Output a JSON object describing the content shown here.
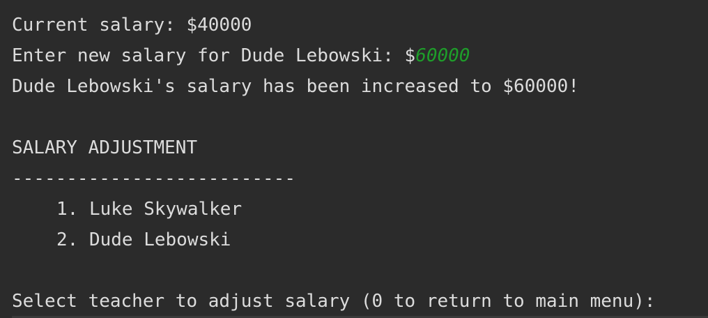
{
  "terminal": {
    "colors": {
      "background": "#2b2b2b",
      "text": "#dcdcdc",
      "input": "#1e9e2a"
    },
    "line1": "Current salary: $40000",
    "line2": {
      "prompt": "Enter new salary for Dude Lebowski: $",
      "input": "60000"
    },
    "line3": "Dude Lebowski's salary has been increased to $60000!",
    "menu": {
      "title": "SALARY ADJUSTMENT",
      "divider": "--------------------------",
      "items": [
        {
          "label": "1. Luke Skywalker"
        },
        {
          "label": "2. Dude Lebowski"
        }
      ]
    },
    "prompt": "Select teacher to adjust salary (0 to return to main menu):"
  }
}
